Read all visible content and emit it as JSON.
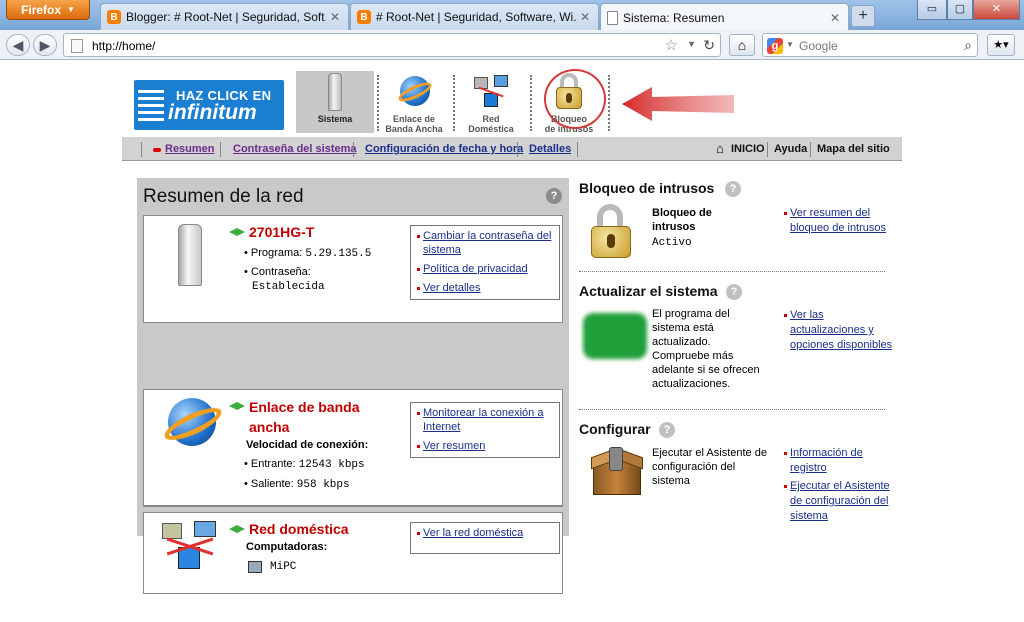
{
  "browser": {
    "app_button": "Firefox",
    "tabs": [
      {
        "label": "Blogger: # Root-Net | Seguridad, Soft...",
        "active": false
      },
      {
        "label": "# Root-Net | Seguridad, Software, Wi...",
        "active": false
      },
      {
        "label": "Sistema: Resumen",
        "active": true
      }
    ],
    "url": "http://home/",
    "search_placeholder": "Google"
  },
  "header": {
    "logo": {
      "line1": "HAZ CLICK EN",
      "line2": "infinitum"
    },
    "nav": [
      {
        "label1": "Sistema",
        "label2": "",
        "selected": true,
        "icon": "modem-icon"
      },
      {
        "label1": "Enlace de",
        "label2": "Banda Ancha",
        "selected": false,
        "icon": "globe-icon"
      },
      {
        "label1": "Red",
        "label2": "Doméstica",
        "selected": false,
        "icon": "network-icon"
      },
      {
        "label1": "Bloqueo",
        "label2": "de intrusos",
        "selected": false,
        "icon": "padlock-icon"
      }
    ]
  },
  "subnav": {
    "items": [
      "Resumen",
      "Contraseña del sistema",
      "Configuración de fecha y hora",
      "Detalles"
    ],
    "right": [
      "INICIO",
      "Ayuda",
      "Mapa del sitio"
    ]
  },
  "summary": {
    "title": "Resumen de la red",
    "device": {
      "name": "2701HG-T",
      "program_label": "Programa:",
      "program_value": "5.29.135.5",
      "password_label": "Contraseña:",
      "password_value": "Establecida",
      "links": [
        "Cambiar la contraseña del sistema",
        "Política de privacidad",
        "Ver detalles"
      ]
    },
    "broadband": {
      "title_line1": "Enlace de banda",
      "title_line2": "ancha",
      "speed_label": "Velocidad de conexión:",
      "in_label": "Entrante:",
      "in_value": "12543 kbps",
      "out_label": "Saliente:",
      "out_value": "958 kbps",
      "links": [
        "Monitorear la conexión a Internet",
        "Ver resumen"
      ]
    },
    "home_network": {
      "title": "Red doméstica",
      "computers_label": "Computadoras:",
      "pc_name": "MiPC",
      "links": [
        "Ver la red doméstica"
      ]
    }
  },
  "right": {
    "intrusion": {
      "title": "Bloqueo de intrusos",
      "status_title_1": "Bloqueo de",
      "status_title_2": "intrusos",
      "status_value": "Activo",
      "links": [
        "Ver resumen del bloqueo de intrusos"
      ]
    },
    "update": {
      "title": "Actualizar el sistema",
      "text": "El programa del sistema está actualizado. Compruebe más adelante si se ofrecen actualizaciones.",
      "links": [
        "Ver las actualizaciones y opciones disponibles"
      ]
    },
    "configure": {
      "title": "Configurar",
      "text": "Ejecutar el Asistente de configuración del sistema",
      "links": [
        "Información de registro",
        "Ejecutar el Asistente de configuración del sistema"
      ]
    }
  }
}
